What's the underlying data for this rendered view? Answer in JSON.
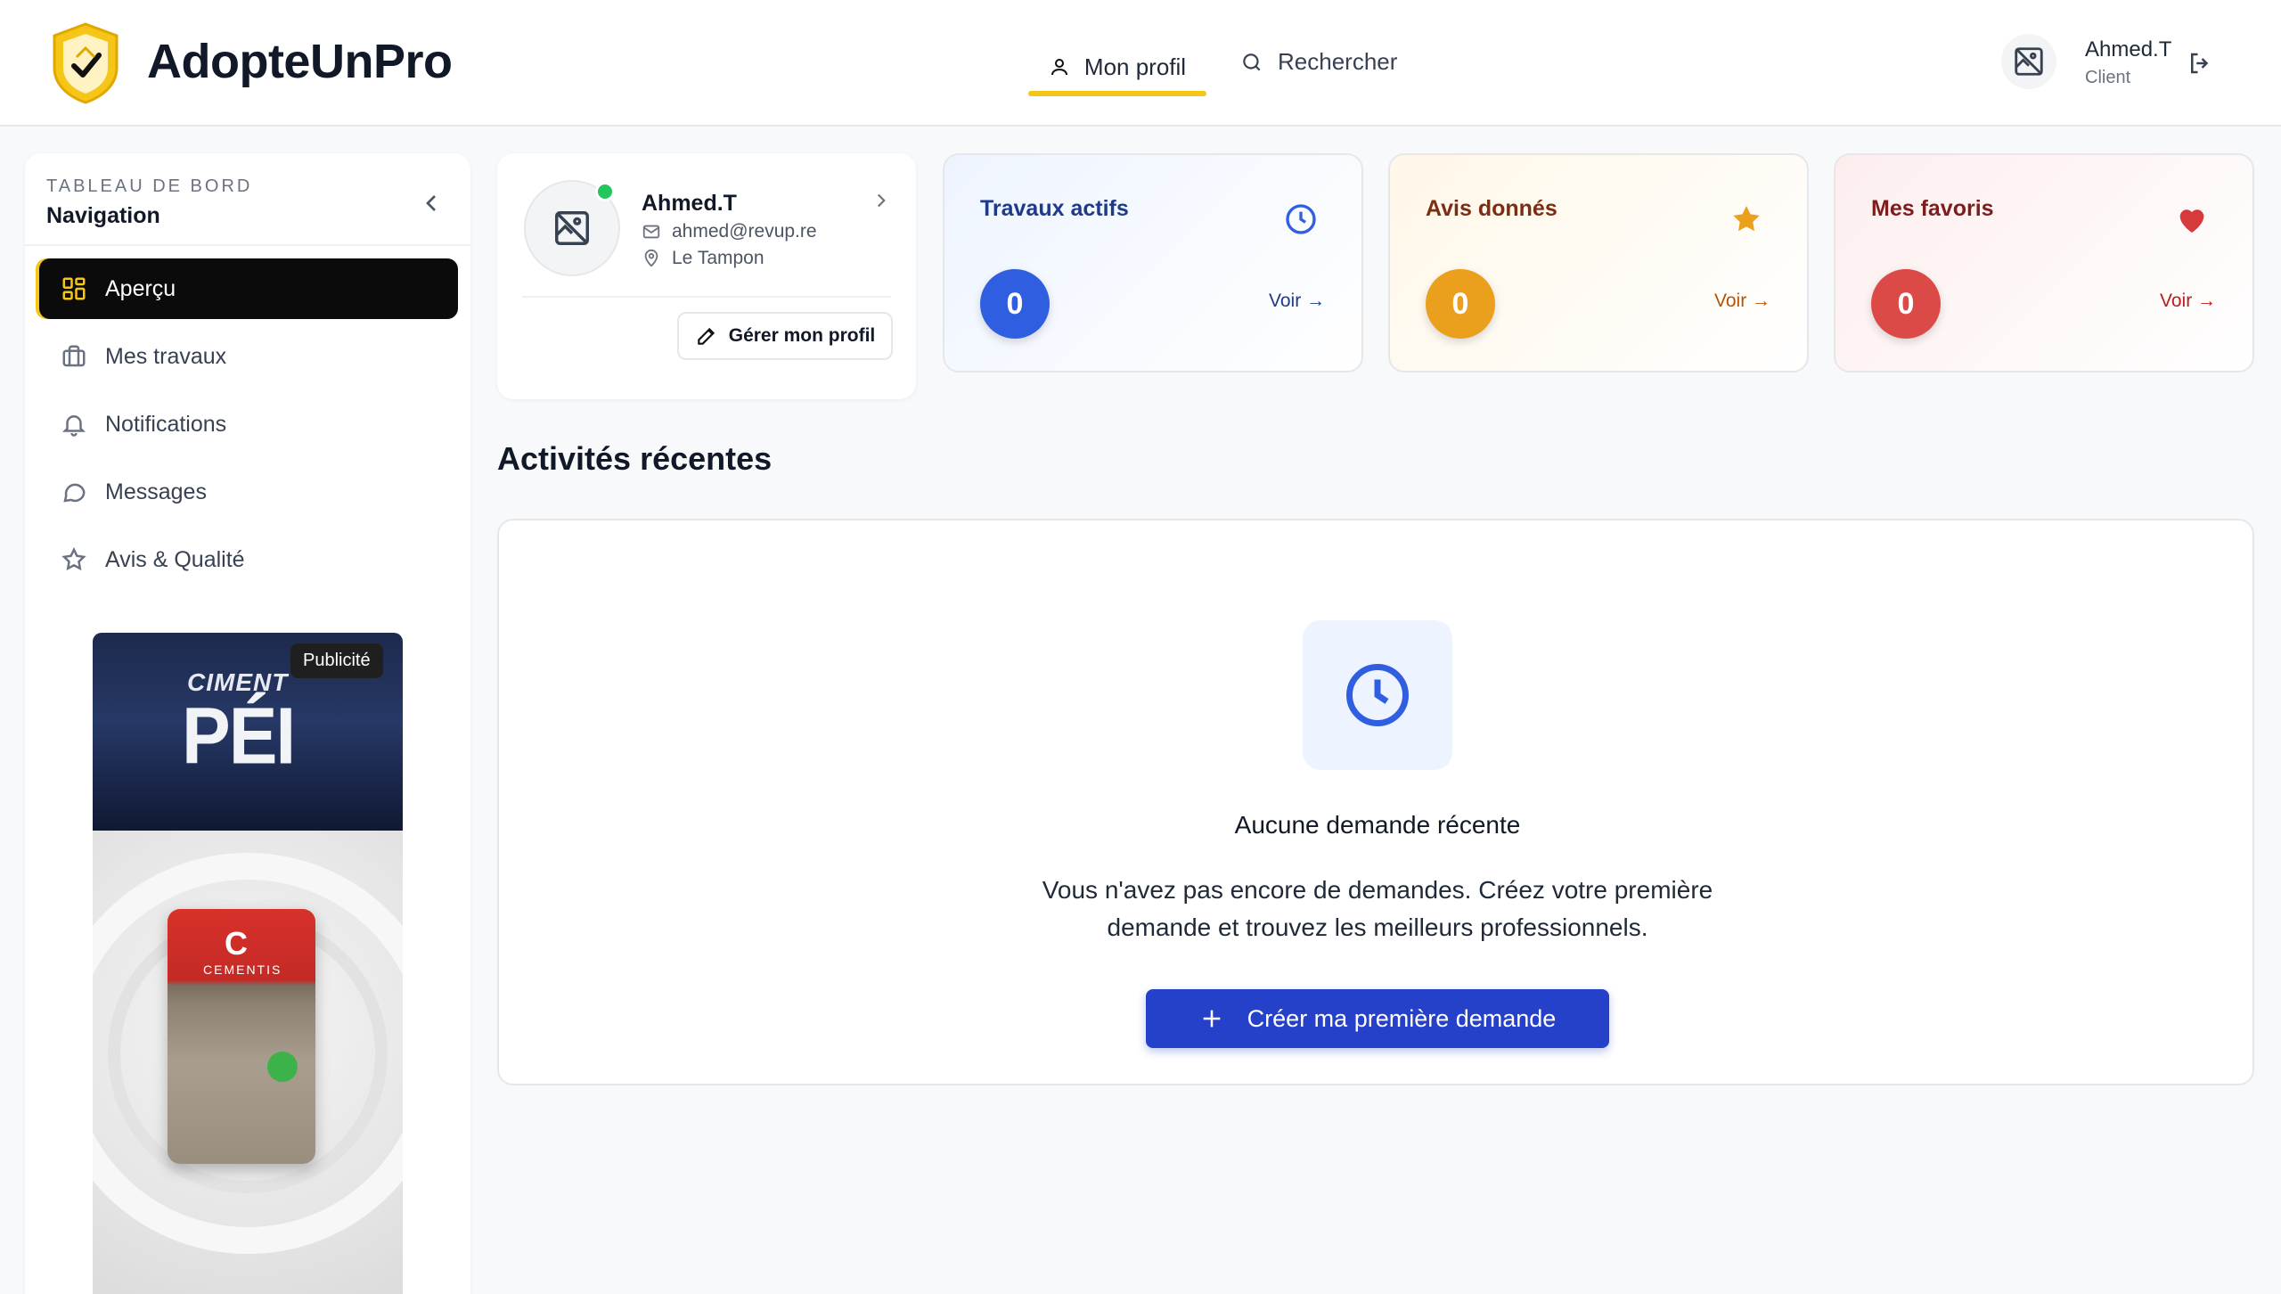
{
  "header": {
    "brand": "AdopteUnPro",
    "tabs": [
      {
        "label": "Mon profil",
        "icon": "user-icon",
        "active": true
      },
      {
        "label": "Rechercher",
        "icon": "search-icon",
        "active": false
      }
    ],
    "user": {
      "name": "Ahmed.T",
      "role": "Client"
    }
  },
  "sidebar": {
    "kicker": "TABLEAU DE BORD",
    "title": "Navigation",
    "items": [
      {
        "label": "Aperçu",
        "icon": "grid-icon",
        "active": true
      },
      {
        "label": "Mes travaux",
        "icon": "briefcase-icon",
        "active": false
      },
      {
        "label": "Notifications",
        "icon": "bell-icon",
        "active": false
      },
      {
        "label": "Messages",
        "icon": "message-icon",
        "active": false
      },
      {
        "label": "Avis & Qualité",
        "icon": "star-icon",
        "active": false
      }
    ],
    "ad": {
      "badge": "Publicité",
      "brand_line": "CIMENT",
      "brand_big": "PÉI",
      "product_name": "CEMENTIS"
    }
  },
  "profile": {
    "name": "Ahmed.T",
    "email": "ahmed@revup.re",
    "location": "Le Tampon",
    "manage_label": "Gérer mon profil",
    "online_color": "#22c55e"
  },
  "stats": [
    {
      "title": "Travaux actifs",
      "value": "0",
      "link": "Voir →",
      "icon": "clock-icon",
      "color": "#2f5fe0"
    },
    {
      "title": "Avis donnés",
      "value": "0",
      "link": "Voir →",
      "icon": "star-icon",
      "color": "#eaa01c"
    },
    {
      "title": "Mes favoris",
      "value": "0",
      "link": "Voir →",
      "icon": "heart-icon",
      "color": "#db4a47"
    }
  ],
  "activity": {
    "title": "Activités récentes",
    "empty_title": "Aucune demande récente",
    "empty_desc": "Vous n'avez pas encore de demandes. Créez votre première demande et trouvez les meilleurs professionnels.",
    "cta_label": "Créer ma première demande"
  },
  "colors": {
    "accent_yellow": "#f5c518",
    "primary_blue": "#2540c9",
    "dark": "#0b0b0b"
  }
}
